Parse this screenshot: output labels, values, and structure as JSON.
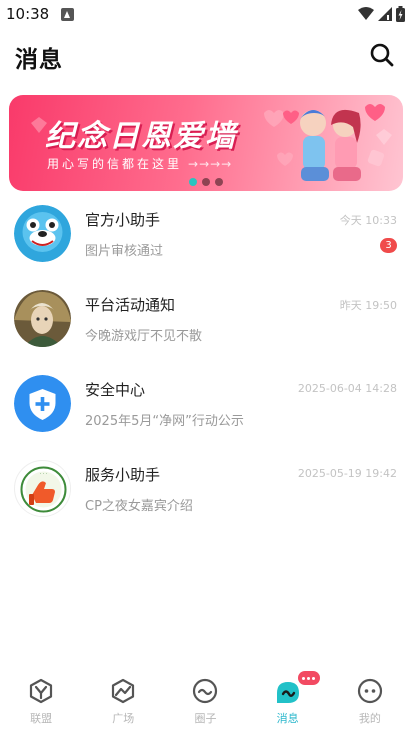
{
  "status_bar": {
    "time": "10:38"
  },
  "header": {
    "title": "消息",
    "search_icon": "search-icon"
  },
  "banner": {
    "title": "纪念日恩爱墙",
    "subtitle": "用心写的信都在这里",
    "arrows": "→→→→",
    "active_index": 0,
    "dot_count": 3,
    "colors": {
      "from": "#f93a6a",
      "to": "#ffc5d2",
      "active_dot": "#2ac4c0"
    }
  },
  "messages": [
    {
      "name": "官方小助手",
      "preview": "图片审核通过",
      "time": "今天 10:33",
      "badge": "3",
      "avatar": "blue-mascot-avatar"
    },
    {
      "name": "平台活动通知",
      "preview": "今晚游戏厅不见不散",
      "time": "昨天 19:50",
      "badge": "",
      "avatar": "game-character-avatar"
    },
    {
      "name": "安全中心",
      "preview": "2025年5月“净网”行动公示",
      "time": "2025-06-04 14:28",
      "badge": "",
      "avatar": "shield-plus-avatar"
    },
    {
      "name": "服务小助手",
      "preview": "CP之夜女嘉宾介绍",
      "time": "2025-05-19 19:42",
      "badge": "",
      "avatar": "mascot-thumbs-up-avatar"
    }
  ],
  "bottom_nav": {
    "items": [
      {
        "label": "联盟",
        "icon": "alliance-icon",
        "active": false
      },
      {
        "label": "广场",
        "icon": "square-icon",
        "active": false
      },
      {
        "label": "圈子",
        "icon": "circle-icon",
        "active": false
      },
      {
        "label": "消息",
        "icon": "message-icon",
        "active": true
      },
      {
        "label": "我的",
        "icon": "profile-icon",
        "active": false
      }
    ],
    "active_color": "#2ab7cc",
    "inactive_color": "#b7b7b7"
  }
}
